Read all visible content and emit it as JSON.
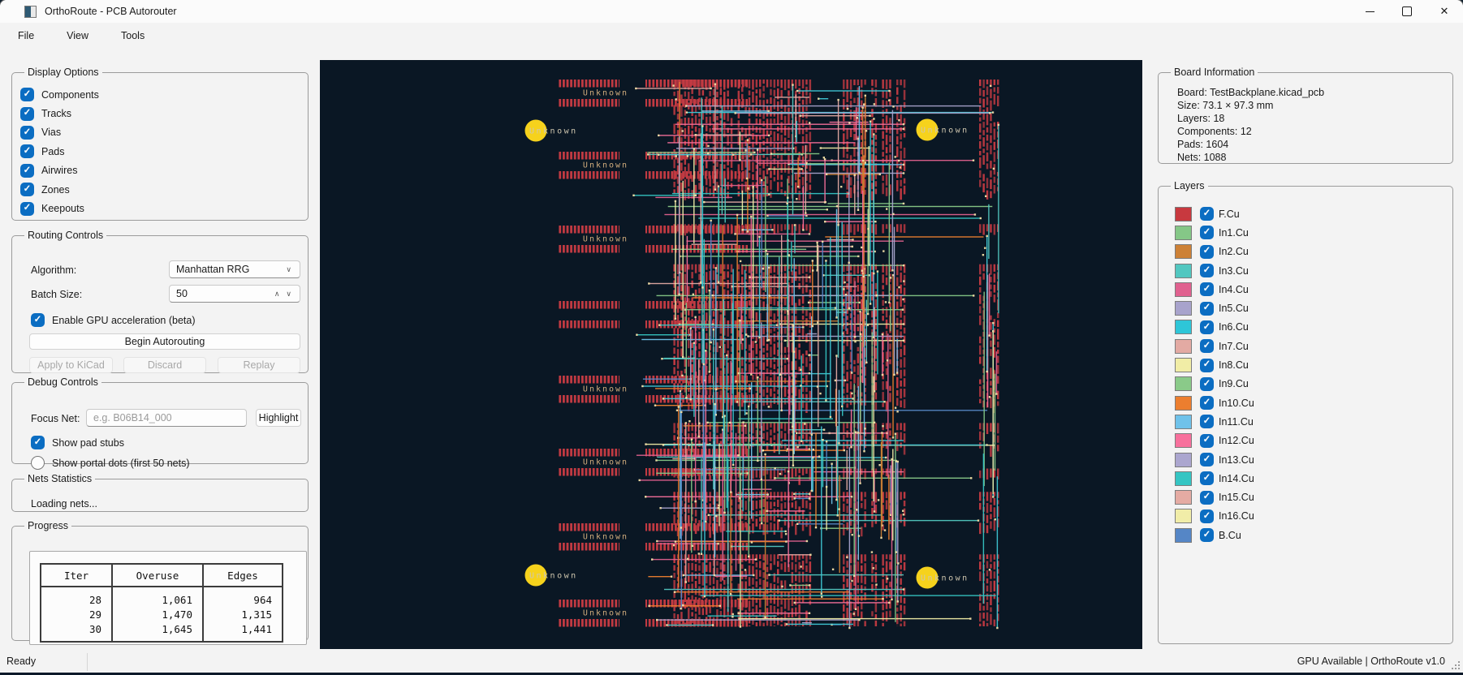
{
  "window": {
    "title": "OrthoRoute - PCB Autorouter"
  },
  "menu": {
    "items": [
      "File",
      "View",
      "Tools"
    ]
  },
  "display_options": {
    "title": "Display Options",
    "items": [
      {
        "label": "Components",
        "checked": true
      },
      {
        "label": "Tracks",
        "checked": true
      },
      {
        "label": "Vias",
        "checked": true
      },
      {
        "label": "Pads",
        "checked": true
      },
      {
        "label": "Airwires",
        "checked": true
      },
      {
        "label": "Zones",
        "checked": true
      },
      {
        "label": "Keepouts",
        "checked": true
      }
    ]
  },
  "routing_controls": {
    "title": "Routing Controls",
    "algorithm_label": "Algorithm:",
    "algorithm_value": "Manhattan RRG",
    "batch_label": "Batch Size:",
    "batch_value": "50",
    "gpu_checkbox_label": "Enable GPU acceleration (beta)",
    "gpu_checked": true,
    "begin_button": "Begin Autorouting",
    "apply_button": "Apply to KiCad",
    "discard_button": "Discard",
    "replay_button": "Replay"
  },
  "debug_controls": {
    "title": "Debug Controls",
    "focus_label": "Focus Net:",
    "focus_placeholder": "e.g. B06B14_000",
    "highlight_button": "Highlight",
    "pad_stubs": {
      "label": "Show pad stubs",
      "checked": true
    },
    "portal_dots": {
      "label": "Show portal dots (first 50 nets)",
      "checked": false
    }
  },
  "nets_statistics": {
    "title": "Nets Statistics",
    "status": "Loading nets..."
  },
  "progress": {
    "title": "Progress",
    "table": {
      "headers": [
        "Iter",
        "Overuse",
        "Edges"
      ],
      "rows": [
        [
          "28",
          "1,061",
          "964"
        ],
        [
          "29",
          "1,470",
          "1,315"
        ],
        [
          "30",
          "1,645",
          "1,441"
        ]
      ]
    }
  },
  "board_information": {
    "title": "Board Information",
    "lines": [
      "Board: TestBackplane.kicad_pcb",
      "Size: 73.1 × 97.3 mm",
      "Layers: 18",
      "Components: 12",
      "Pads: 1604",
      "Nets: 1088"
    ]
  },
  "layers": {
    "title": "Layers",
    "items": [
      {
        "name": "F.Cu",
        "color": "#c8393f",
        "checked": true
      },
      {
        "name": "In1.Cu",
        "color": "#85c787",
        "checked": true
      },
      {
        "name": "In2.Cu",
        "color": "#cd8136",
        "checked": true
      },
      {
        "name": "In3.Cu",
        "color": "#52c7c0",
        "checked": true
      },
      {
        "name": "In4.Cu",
        "color": "#e0618f",
        "checked": true
      },
      {
        "name": "In5.Cu",
        "color": "#a8a3cc",
        "checked": true
      },
      {
        "name": "In6.Cu",
        "color": "#2ec6d8",
        "checked": true
      },
      {
        "name": "In7.Cu",
        "color": "#e3aaa3",
        "checked": true
      },
      {
        "name": "In8.Cu",
        "color": "#f1eda6",
        "checked": true
      },
      {
        "name": "In9.Cu",
        "color": "#8aca89",
        "checked": true
      },
      {
        "name": "In10.Cu",
        "color": "#ec7e2f",
        "checked": true
      },
      {
        "name": "In11.Cu",
        "color": "#6fc2ea",
        "checked": true
      },
      {
        "name": "In12.Cu",
        "color": "#f7709c",
        "checked": true
      },
      {
        "name": "In13.Cu",
        "color": "#aba6cf",
        "checked": true
      },
      {
        "name": "In14.Cu",
        "color": "#35c5c3",
        "checked": true
      },
      {
        "name": "In15.Cu",
        "color": "#e5aba3",
        "checked": true
      },
      {
        "name": "In16.Cu",
        "color": "#f1eda8",
        "checked": true
      },
      {
        "name": "B.Cu",
        "color": "#5586c6",
        "checked": true
      }
    ]
  },
  "status_bar": {
    "left": "Ready",
    "right": "GPU Available | OrthoRoute v1.0"
  },
  "pcb_view": {
    "background": "#0a1724",
    "pad_color": "#c23a42",
    "via_dot_color": "#f2dfa6",
    "marker_color": "#f6d21c",
    "marker_label": "Unknown",
    "strip_label_color": "#d0ac7c",
    "marker_label_color": "#cfc6ae",
    "trace_colors": [
      "#3fc8d6",
      "#52c7c0",
      "#85c787",
      "#8aca89",
      "#ec7e2f",
      "#cd8136",
      "#e0618f",
      "#f7709c",
      "#a8a3cc",
      "#6fc2ea",
      "#f1eda6",
      "#e3aaa3",
      "#5586c6",
      "#35c5c3"
    ]
  }
}
